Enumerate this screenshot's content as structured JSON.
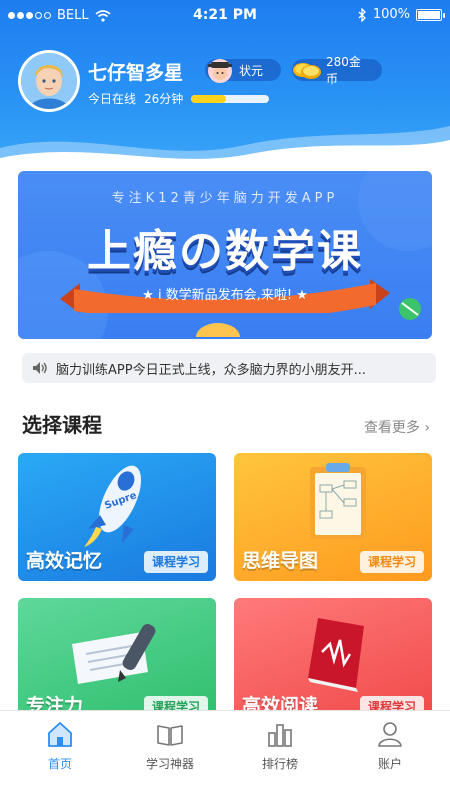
{
  "status_bar": {
    "carrier": "BELL",
    "time": "4:21 PM",
    "battery": "100%"
  },
  "profile": {
    "name": "七仔智多星",
    "online_label": "今日在线",
    "online_time": "26分钟",
    "online_progress": 0.45,
    "rank_label": "状元",
    "coins_label": "280金币"
  },
  "banner": {
    "subtitle": "专注K12青少年脑力开发APP",
    "title": "上瘾の数学课",
    "ribbon": "★ i 数学新品发布会,来啦! ★"
  },
  "notice": {
    "text": "脑力训练APP今日正式上线，众多脑力界的小朋友开..."
  },
  "section": {
    "title": "选择课程",
    "more": "查看更多"
  },
  "courses": [
    {
      "name": "高效记忆",
      "tag": "课程学习",
      "color_top": "#2aa9f5",
      "color_bottom": "#1a7ae0",
      "tag_color": "#1a7ae0"
    },
    {
      "name": "思维导图",
      "tag": "课程学习",
      "color_top": "#ffc53d",
      "color_bottom": "#ff9a1f",
      "tag_color": "#f08a14"
    },
    {
      "name": "专注力",
      "tag": "课程学习",
      "color_top": "#5ed89a",
      "color_bottom": "#2fbe6d",
      "tag_color": "#23a35a"
    },
    {
      "name": "高效阅读",
      "tag": "课程学习",
      "color_top": "#ff7a7a",
      "color_bottom": "#f04848",
      "tag_color": "#e23a3a"
    }
  ],
  "tabs": [
    {
      "label": "首页",
      "icon": "home-icon",
      "active": true
    },
    {
      "label": "学习神器",
      "icon": "book-icon",
      "active": false
    },
    {
      "label": "排行榜",
      "icon": "ranking-icon",
      "active": false
    },
    {
      "label": "账户",
      "icon": "user-icon",
      "active": false
    }
  ],
  "colors": {
    "primary": "#2b8ef0",
    "progress": "#ffd21e"
  }
}
